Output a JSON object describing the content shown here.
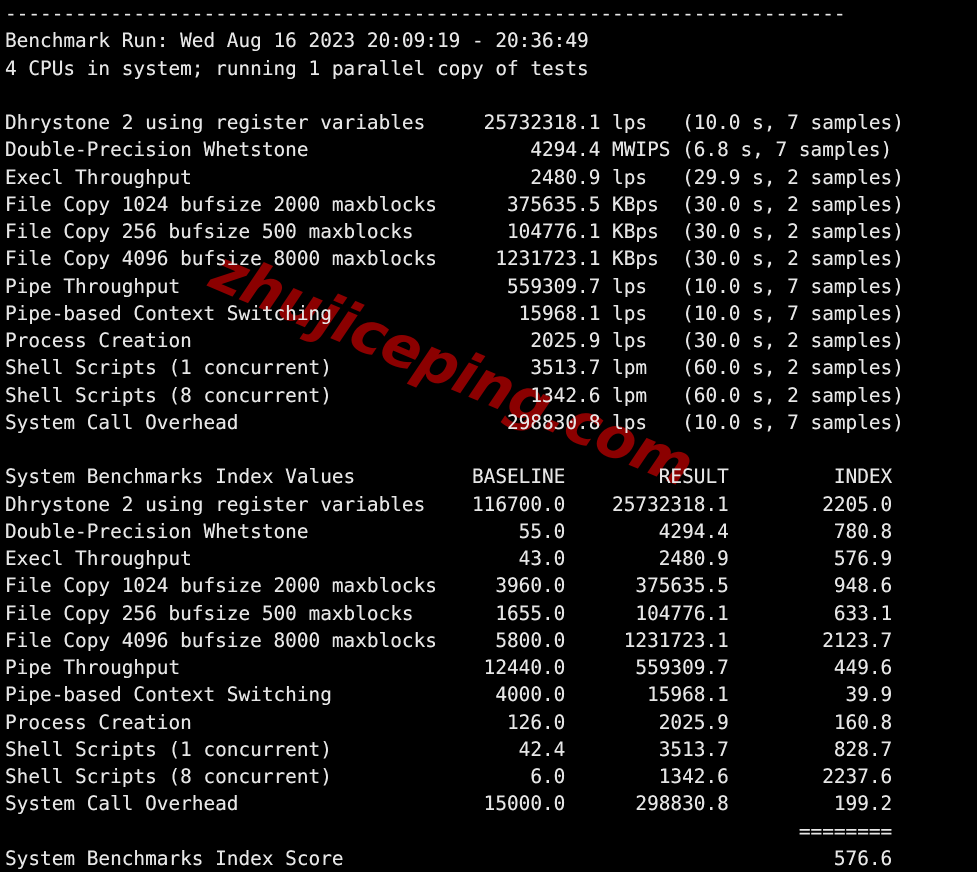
{
  "terminal": {
    "title": "UnixBench Benchmark Result",
    "colors": {
      "background": "#000000",
      "foreground": "#e6e6e6",
      "watermark": "#8b0000"
    },
    "separator_top": "------------------------------------------------------------------------",
    "header": {
      "benchmark_run": "Benchmark Run: Wed Aug 16 2023 20:09:19 - 20:36:49",
      "cpu_line": "4 CPUs in system; running 1 parallel copy of tests"
    },
    "raw_results": {
      "rows": [
        {
          "name": "Dhrystone 2 using register variables",
          "value": "25732318.1",
          "unit": "lps",
          "duration": "10.0 s",
          "samples": "7 samples"
        },
        {
          "name": "Double-Precision Whetstone",
          "value": "4294.4",
          "unit": "MWIPS",
          "duration": "6.8 s",
          "samples": "7 samples"
        },
        {
          "name": "Execl Throughput",
          "value": "2480.9",
          "unit": "lps",
          "duration": "29.9 s",
          "samples": "2 samples"
        },
        {
          "name": "File Copy 1024 bufsize 2000 maxblocks",
          "value": "375635.5",
          "unit": "KBps",
          "duration": "30.0 s",
          "samples": "2 samples"
        },
        {
          "name": "File Copy 256 bufsize 500 maxblocks",
          "value": "104776.1",
          "unit": "KBps",
          "duration": "30.0 s",
          "samples": "2 samples"
        },
        {
          "name": "File Copy 4096 bufsize 8000 maxblocks",
          "value": "1231723.1",
          "unit": "KBps",
          "duration": "30.0 s",
          "samples": "2 samples"
        },
        {
          "name": "Pipe Throughput",
          "value": "559309.7",
          "unit": "lps",
          "duration": "10.0 s",
          "samples": "7 samples"
        },
        {
          "name": "Pipe-based Context Switching",
          "value": "15968.1",
          "unit": "lps",
          "duration": "10.0 s",
          "samples": "7 samples"
        },
        {
          "name": "Process Creation",
          "value": "2025.9",
          "unit": "lps",
          "duration": "30.0 s",
          "samples": "2 samples"
        },
        {
          "name": "Shell Scripts (1 concurrent)",
          "value": "3513.7",
          "unit": "lpm",
          "duration": "60.0 s",
          "samples": "2 samples"
        },
        {
          "name": "Shell Scripts (8 concurrent)",
          "value": "1342.6",
          "unit": "lpm",
          "duration": "60.0 s",
          "samples": "2 samples"
        },
        {
          "name": "System Call Overhead",
          "value": "298830.8",
          "unit": "lps",
          "duration": "10.0 s",
          "samples": "7 samples"
        }
      ]
    },
    "index_table": {
      "title": "System Benchmarks Index Values",
      "columns": [
        "BASELINE",
        "RESULT",
        "INDEX"
      ],
      "rows": [
        {
          "name": "Dhrystone 2 using register variables",
          "baseline": "116700.0",
          "result": "25732318.1",
          "index": "2205.0"
        },
        {
          "name": "Double-Precision Whetstone",
          "baseline": "55.0",
          "result": "4294.4",
          "index": "780.8"
        },
        {
          "name": "Execl Throughput",
          "baseline": "43.0",
          "result": "2480.9",
          "index": "576.9"
        },
        {
          "name": "File Copy 1024 bufsize 2000 maxblocks",
          "baseline": "3960.0",
          "result": "375635.5",
          "index": "948.6"
        },
        {
          "name": "File Copy 256 bufsize 500 maxblocks",
          "baseline": "1655.0",
          "result": "104776.1",
          "index": "633.1"
        },
        {
          "name": "File Copy 4096 bufsize 8000 maxblocks",
          "baseline": "5800.0",
          "result": "1231723.1",
          "index": "2123.7"
        },
        {
          "name": "Pipe Throughput",
          "baseline": "12440.0",
          "result": "559309.7",
          "index": "449.6"
        },
        {
          "name": "Pipe-based Context Switching",
          "baseline": "4000.0",
          "result": "15968.1",
          "index": "39.9"
        },
        {
          "name": "Process Creation",
          "baseline": "126.0",
          "result": "2025.9",
          "index": "160.8"
        },
        {
          "name": "Shell Scripts (1 concurrent)",
          "baseline": "42.4",
          "result": "3513.7",
          "index": "828.7"
        },
        {
          "name": "Shell Scripts (8 concurrent)",
          "baseline": "6.0",
          "result": "1342.6",
          "index": "2237.6"
        },
        {
          "name": "System Call Overhead",
          "baseline": "15000.0",
          "result": "298830.8",
          "index": "199.2"
        }
      ],
      "score_rule": "========",
      "score_label": "System Benchmarks Index Score",
      "score_value": "576.6"
    }
  },
  "watermark": {
    "text": "zhujiceping.com"
  }
}
